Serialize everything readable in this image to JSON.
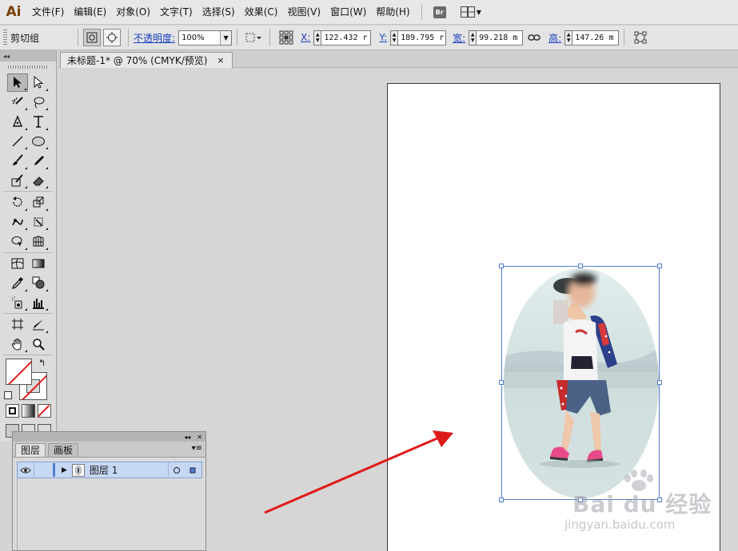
{
  "app": {
    "logo": "Ai"
  },
  "menu": {
    "items": [
      {
        "label": "文件(F)"
      },
      {
        "label": "编辑(E)"
      },
      {
        "label": "对象(O)"
      },
      {
        "label": "文字(T)"
      },
      {
        "label": "选择(S)"
      },
      {
        "label": "效果(C)"
      },
      {
        "label": "视图(V)"
      },
      {
        "label": "窗口(W)"
      },
      {
        "label": "帮助(H)"
      }
    ],
    "bridge_label": "Br",
    "workspace_icon": "workspace-grid-icon"
  },
  "control": {
    "selection_label": "剪切组",
    "opacity_label": "不透明度:",
    "opacity_value": "100%",
    "x_label": "X:",
    "x_value": "122.432 r",
    "y_label": "Y:",
    "y_value": "189.795 r",
    "w_label": "宽:",
    "w_value": "99.218 m",
    "h_label": "高:",
    "h_value": "147.26 m"
  },
  "document": {
    "tab_title": "未标题-1* @ 70% (CMYK/预览)",
    "close_glyph": "×"
  },
  "tools": {
    "rows": [
      [
        "selection-tool",
        "direct-selection-tool"
      ],
      [
        "magic-wand-tool",
        "lasso-tool"
      ],
      [
        "pen-tool",
        "type-tool"
      ],
      [
        "line-segment-tool",
        "ellipse-tool"
      ],
      [
        "paintbrush-tool",
        "pencil-tool"
      ],
      [
        "blob-brush-tool",
        "eraser-tool"
      ],
      [
        "rotate-tool",
        "scale-tool"
      ],
      [
        "warp-tool",
        "free-transform-tool"
      ],
      [
        "shape-builder-tool",
        "perspective-grid-tool"
      ],
      [
        "mesh-tool",
        "gradient-tool"
      ],
      [
        "eyedropper-tool",
        "blend-tool"
      ],
      [
        "symbol-sprayer-tool",
        "column-graph-tool"
      ],
      [
        "artboard-tool",
        "slice-tool"
      ],
      [
        "hand-tool",
        "zoom-tool"
      ]
    ]
  },
  "layers": {
    "tabs": [
      {
        "label": "图层"
      },
      {
        "label": "画板"
      }
    ],
    "rows": [
      {
        "name": "图层 1"
      }
    ]
  },
  "watermark": {
    "main": "Bai du 经验",
    "sub": "jingyan.baidu.com"
  },
  "colors": {
    "accent": "#4f7fd0",
    "arrow": "#e01a1a"
  }
}
